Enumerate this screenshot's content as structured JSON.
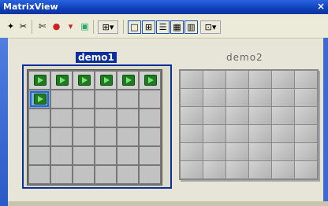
{
  "window": {
    "title": "MatrixView",
    "close_glyph": "×"
  },
  "toolbar": {
    "icons": [
      "wand-icon",
      "cut-icon",
      "scissors-icon",
      "stop-icon",
      "filter-icon",
      "sheet-icon",
      "layout-dropdown-icon",
      "single-view-icon",
      "grid-view-icon",
      "list-view-icon",
      "detail-view-icon",
      "column-view-icon",
      "preset-dropdown-icon"
    ]
  },
  "views": {
    "left": {
      "label": "demo1",
      "rows": 6,
      "cols": 6
    },
    "right": {
      "label": "demo2",
      "rows": 6,
      "cols": 6
    }
  },
  "left_cells": {
    "arrow_row": [
      true,
      true,
      true,
      true,
      true,
      true
    ],
    "selected_cell": {
      "row": 2,
      "col": 1
    }
  },
  "colors": {
    "accent": "#0a2f9c",
    "arrow_green": "#1f7a1f"
  }
}
